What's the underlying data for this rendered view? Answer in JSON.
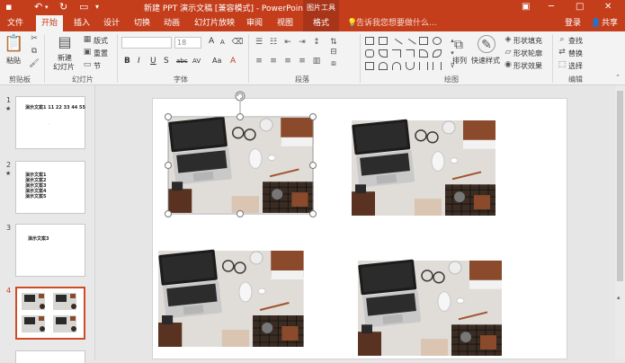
{
  "window": {
    "title": "新建 PPT 演示文稿 [兼容模式] - PowerPoint",
    "contextual_tools": "图片工具",
    "share_label": "共享"
  },
  "tabs": [
    {
      "label": "文件"
    },
    {
      "label": "开始"
    },
    {
      "label": "插入"
    },
    {
      "label": "设计"
    },
    {
      "label": "切换"
    },
    {
      "label": "动画"
    },
    {
      "label": "幻灯片放映"
    },
    {
      "label": "审阅"
    },
    {
      "label": "视图"
    },
    {
      "label": "格式"
    }
  ],
  "tell_me": "告诉我您想要做什么...",
  "login": "登录",
  "ribbon": {
    "clipboard": {
      "paste": "粘贴",
      "group": "剪贴板"
    },
    "slides": {
      "new_slide_1": "新建",
      "new_slide_2": "幻灯片",
      "layout": "版式",
      "reset": "重置",
      "section": "节",
      "group": "幻灯片"
    },
    "font": {
      "group": "字体",
      "size": "18",
      "bold": "B",
      "italic": "I",
      "underline": "U",
      "strike": "S",
      "shadow": "abc",
      "spacing": "AV",
      "case": "Aa",
      "color": "A",
      "grow": "A",
      "shrink": "A"
    },
    "paragraph": {
      "group": "段落"
    },
    "drawing": {
      "arrange": "排列",
      "quick_styles": "快速样式",
      "fill": "形状填充",
      "outline": "形状轮廓",
      "effects": "形状效果",
      "group": "绘图"
    },
    "editing": {
      "find": "查找",
      "replace": "替换",
      "select": "选择",
      "group": "编辑"
    }
  },
  "slides": [
    {
      "num": "1",
      "star": "★",
      "lines": [
        "演示文案1 11 22 33 44 55"
      ]
    },
    {
      "num": "2",
      "star": "★",
      "lines": [
        "演示文案1",
        "演示文案2",
        "演示文案3",
        "演示文案4",
        "演示文案5"
      ]
    },
    {
      "num": "3",
      "star": "",
      "lines": [
        "演示文案3"
      ]
    },
    {
      "num": "4",
      "star": "",
      "lines": []
    }
  ]
}
